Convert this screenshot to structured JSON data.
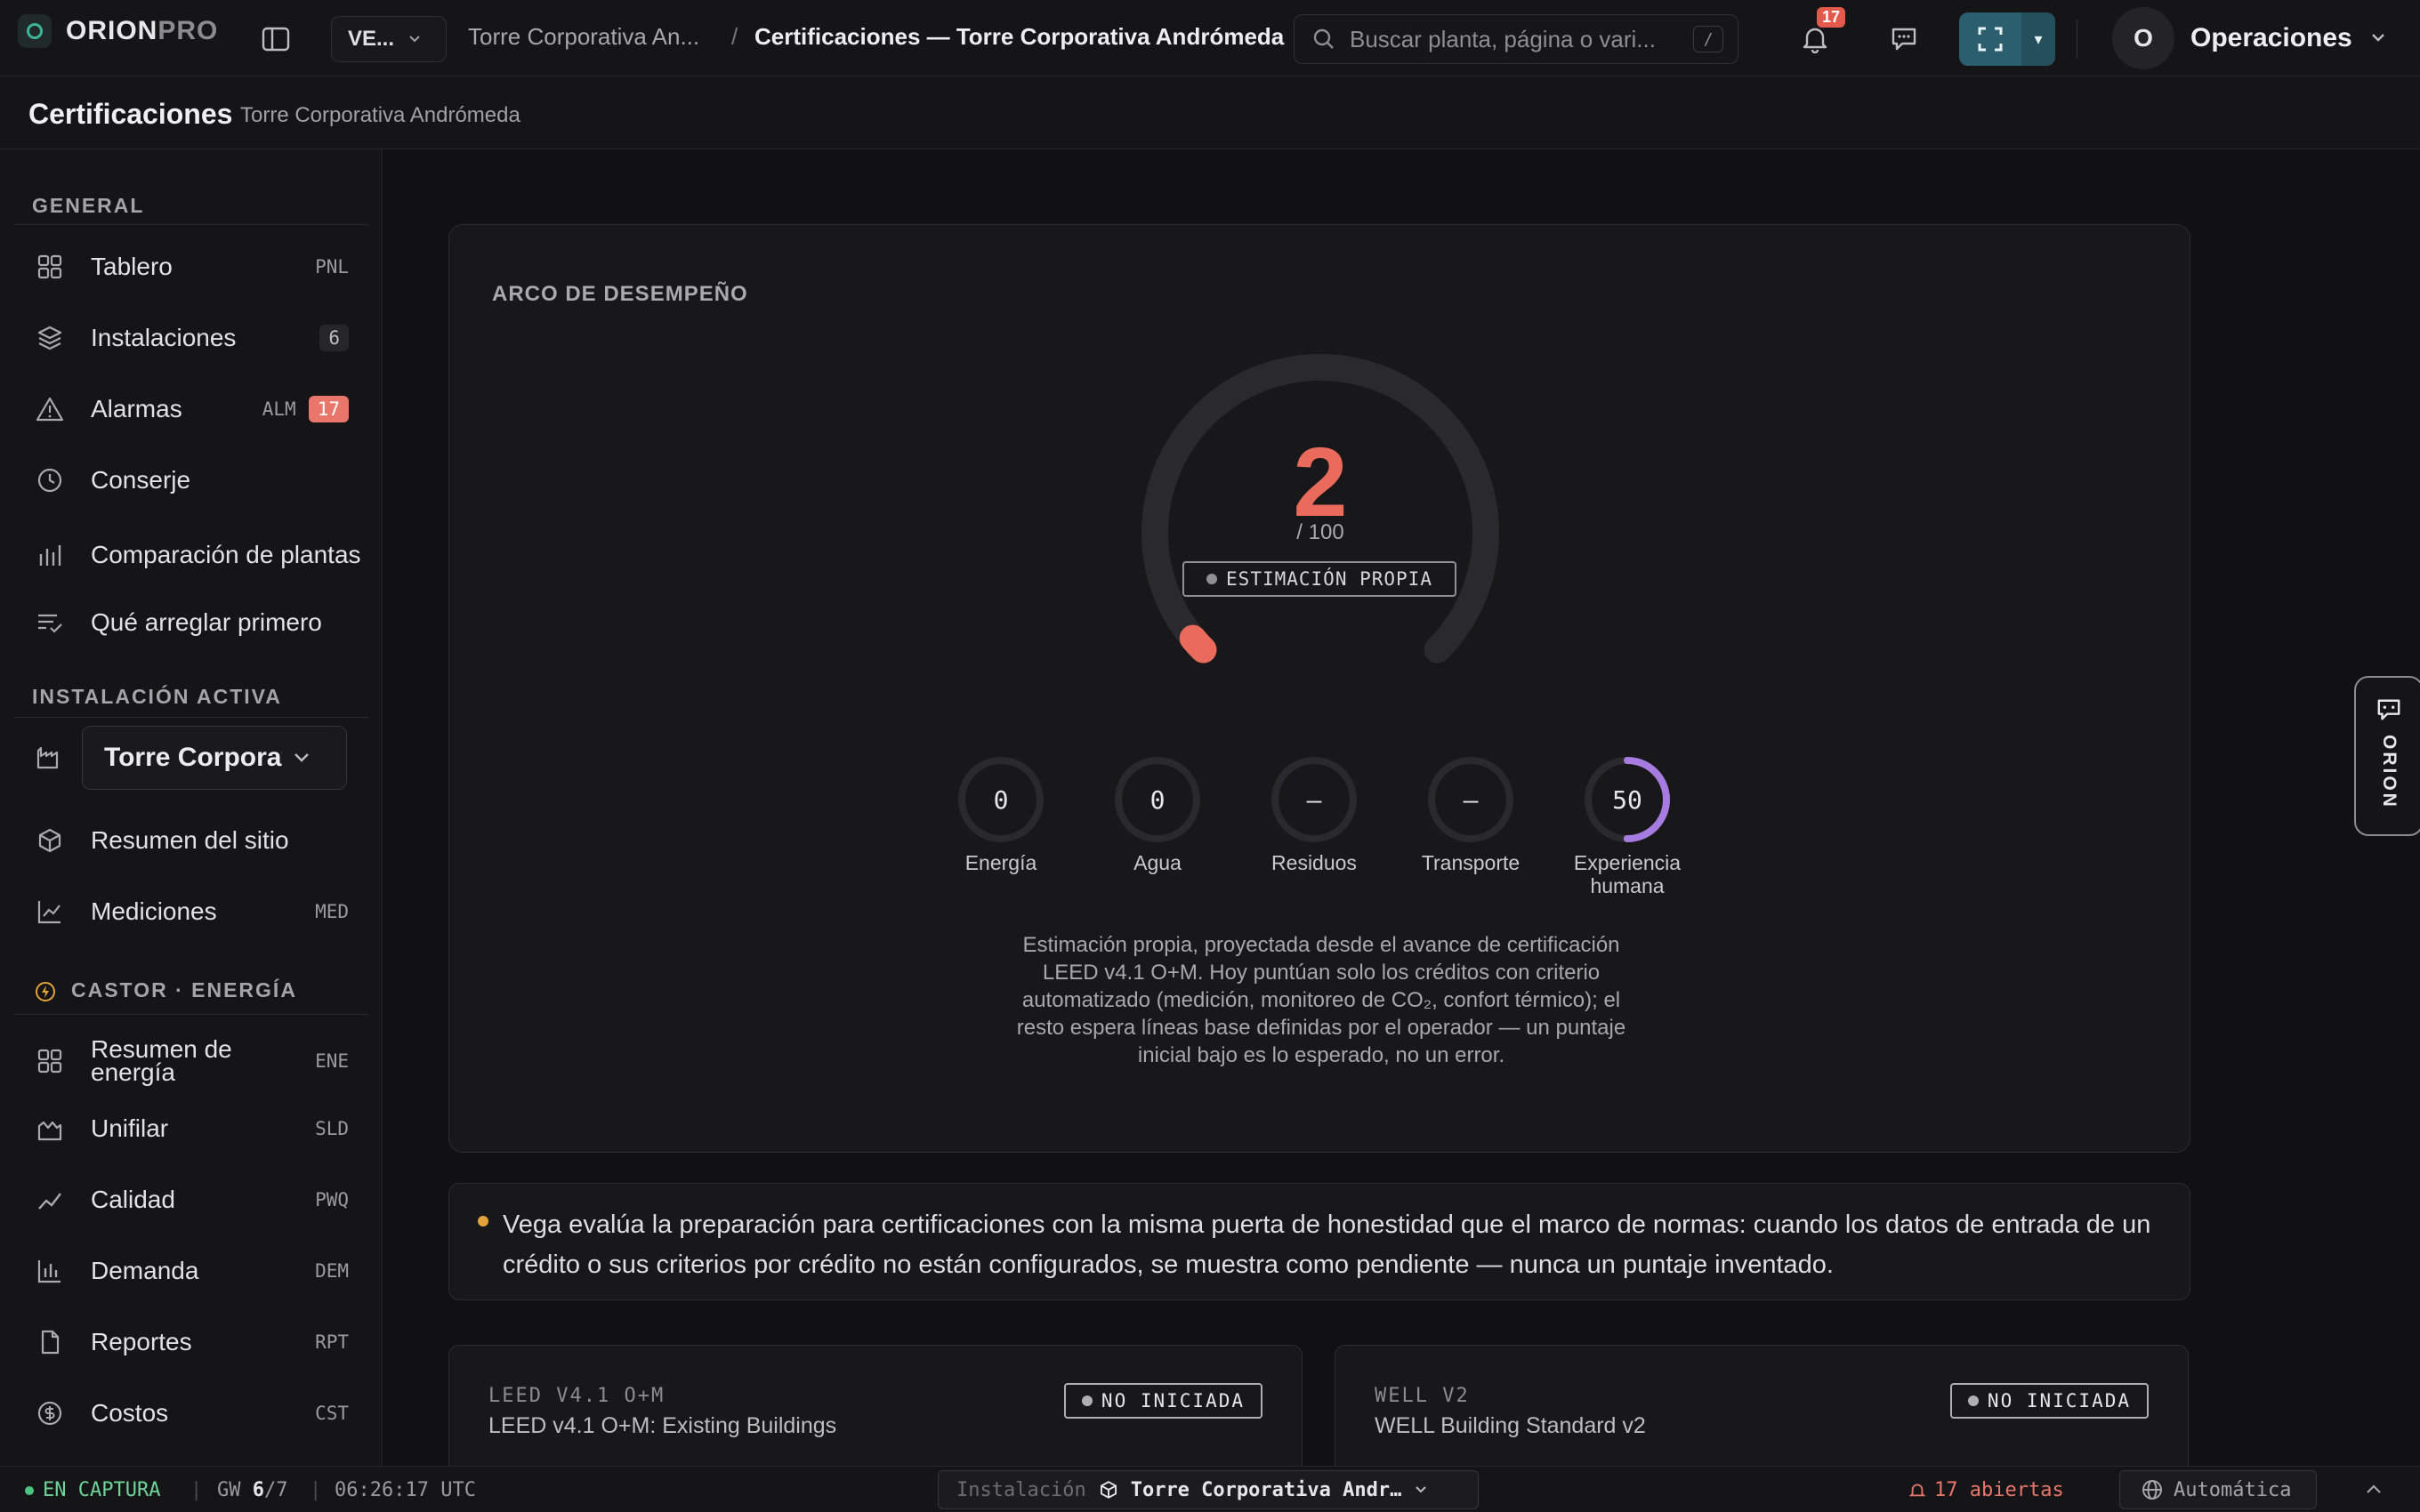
{
  "app": {
    "logo_main": "ORION",
    "logo_sub": "PRO"
  },
  "topbar": {
    "workspace": "VE...",
    "breadcrumb_parent": "Torre Corporativa An...",
    "breadcrumb_sep": "/",
    "breadcrumb_current": "Certificaciones — Torre Corporativa Andrómeda",
    "search_placeholder": "Buscar planta, página o vari...",
    "search_shortcut": "/",
    "notifications_count": "17",
    "user_initial": "O",
    "user_name": "Operaciones"
  },
  "subheader": {
    "title": "Certificaciones",
    "site": "Torre Corporativa Andrómeda"
  },
  "sidebar": {
    "general_label": "GENERAL",
    "items": [
      {
        "label": "Tablero",
        "code": "PNL"
      },
      {
        "label": "Instalaciones",
        "count": "6"
      },
      {
        "label": "Alarmas",
        "code": "ALM",
        "count": "17"
      },
      {
        "label": "Conserje"
      },
      {
        "label": "Comparación de plantas"
      },
      {
        "label": "Qué arreglar primero"
      }
    ],
    "active_label": "INSTALACIÓN ACTIVA",
    "active_site": "Torre Corporativa Andrómeda",
    "site_items": [
      {
        "label": "Resumen del sitio"
      },
      {
        "label": "Mediciones",
        "code": "MED"
      }
    ],
    "castor_label": "CASTOR · ENERGÍA",
    "energy_items": [
      {
        "label": "Resumen de energía",
        "code": "ENE"
      },
      {
        "label": "Unifilar",
        "code": "SLD"
      },
      {
        "label": "Calidad",
        "code": "PWQ"
      },
      {
        "label": "Demanda",
        "code": "DEM"
      },
      {
        "label": "Reportes",
        "code": "RPT"
      },
      {
        "label": "Costos",
        "code": "CST"
      }
    ]
  },
  "arc": {
    "title": "ARCO DE DESEMPEÑO",
    "score": "2",
    "score_value": 2,
    "denominator": "/ 100",
    "tag": "ESTIMACIÓN PROPIA",
    "subscores": [
      {
        "value": "0",
        "label": "Energía",
        "fill": 0
      },
      {
        "value": "0",
        "label": "Agua",
        "fill": 0
      },
      {
        "value": "–",
        "label": "Residuos",
        "fill": 0
      },
      {
        "value": "–",
        "label": "Transporte",
        "fill": 0
      },
      {
        "value": "50",
        "label": "Experiencia humana",
        "fill": 0.5
      }
    ],
    "note": "Estimación propia, proyectada desde el avance de certificación LEED v4.1 O+M. Hoy puntúan solo los créditos con criterio automatizado (medición, monitoreo de CO₂, confort térmico); el resto espera líneas base definidas por el operador — un puntaje inicial bajo es lo esperado, no un error."
  },
  "notice": "Vega evalúa la preparación para certificaciones con la misma puerta de honestidad que el marco de normas: cuando los datos de entrada de un crédito o sus criterios por crédito no están configurados, se muestra como pendiente — nunca un puntaje inventado.",
  "certs": [
    {
      "code": "LEED V4.1 O+M",
      "name": "LEED v4.1 O+M: Existing Buildings",
      "status": "NO INICIADA"
    },
    {
      "code": "WELL V2",
      "name": "WELL Building Standard v2",
      "status": "NO INICIADA"
    }
  ],
  "orion_tab": "ORION",
  "statusbar": {
    "live": "EN CAPTURA",
    "gw_label": "GW",
    "gw_value": "6",
    "gw_total": "/7",
    "time": "06:26:17 UTC",
    "site_label": "Instalación",
    "site_value": "Torre Corporativa Andr…",
    "alarms": "17 abiertas",
    "mode": "Automática"
  },
  "colors": {
    "accent": "#ea6b5c",
    "purple": "#a77ce0",
    "teal": "#2c5f6e"
  }
}
